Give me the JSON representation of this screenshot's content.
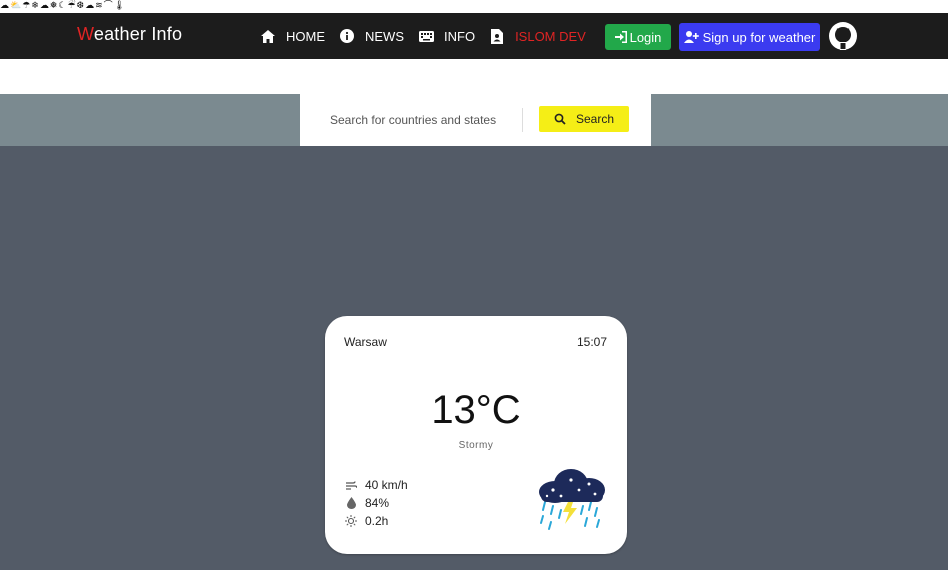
{
  "icon_strip": [
    "cloud-icon",
    "cloud-sun-icon",
    "cloud-rain-icon",
    "snowflake-icon",
    "cloud-drizzle-icon",
    "cloud-snow-icon",
    "cloud-moon-icon",
    "umbrella-icon",
    "sleet-icon",
    "moon-cloud-icon",
    "cloud-wind-icon",
    "rainbow-icon",
    "thermometer-icon"
  ],
  "brand": {
    "w": "W",
    "rest": "eather",
    "info": "Info"
  },
  "nav": {
    "home": "HOME",
    "news": "NEWS",
    "info": "INFO",
    "dev": "ISLOM DEV"
  },
  "buttons": {
    "login": "Login",
    "signup": "Sign up for weather"
  },
  "search": {
    "placeholder": "Search for countries and states",
    "button": "Search"
  },
  "weather": {
    "city": "Warsaw",
    "time": "15:07",
    "temperature": "13°C",
    "condition": "Stormy",
    "wind": "40 km/h",
    "humidity": "84%",
    "sunshine": "0.2h"
  },
  "colors": {
    "navbar": "#1c1c1c",
    "brand_accent": "#e02424",
    "login": "#22a84a",
    "signup": "#3b3bf0",
    "search_button": "#f5ee16",
    "band": "#7b8a90",
    "main_bg": "#535b67"
  }
}
